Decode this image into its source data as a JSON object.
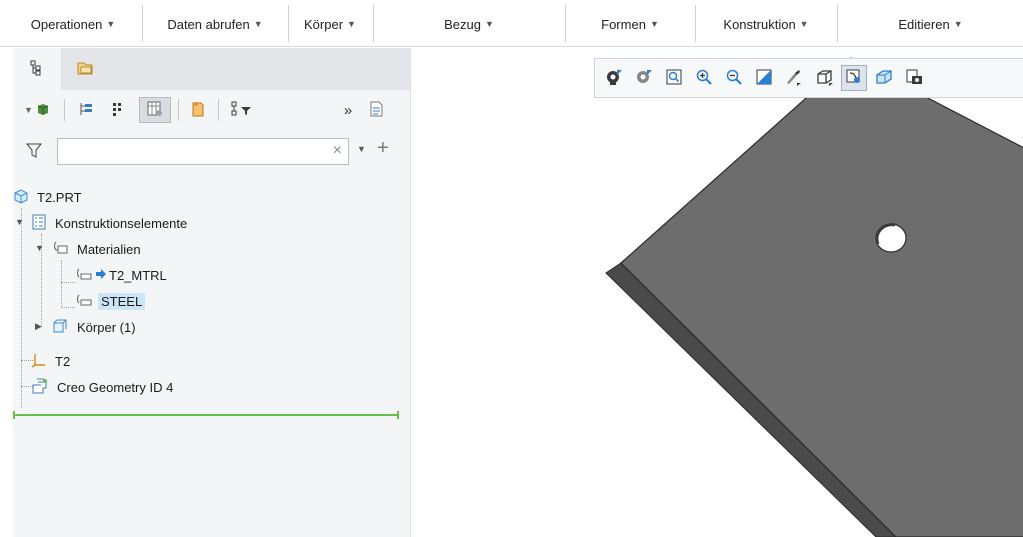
{
  "ribbon": {
    "groups": [
      {
        "label": "Operationen"
      },
      {
        "label": "Daten abrufen"
      },
      {
        "label": "Körper"
      },
      {
        "label": "Bezug"
      },
      {
        "label": "Formen"
      },
      {
        "label": "Konstruktion"
      },
      {
        "label": "Editieren"
      }
    ],
    "dropdown_glyph": "▼"
  },
  "panel": {
    "tabs": [
      {
        "icon": "model-tree-icon",
        "active": true
      },
      {
        "icon": "folder-browser-icon",
        "active": false
      }
    ],
    "filter": {
      "value": "",
      "placeholder": "",
      "clear_glyph": "×",
      "dropdown_glyph": "▼",
      "add_glyph": "+"
    },
    "toolbar": {
      "more_glyph": "»"
    }
  },
  "tree": {
    "root": "T2.PRT",
    "features": "Konstruktionselemente",
    "materials": "Materialien",
    "material_1": "T2_MTRL",
    "material_2": "STEEL",
    "bodies": "Körper (1)",
    "csys": "T2",
    "geometry_id": "Creo Geometry ID 4"
  },
  "colors": {
    "selection": "#cde6f7",
    "insert_marker": "#6abf4b",
    "model_face": "#6d6d6d",
    "model_edge": "#2b2b2b",
    "accent_blue": "#2a7fd4"
  }
}
